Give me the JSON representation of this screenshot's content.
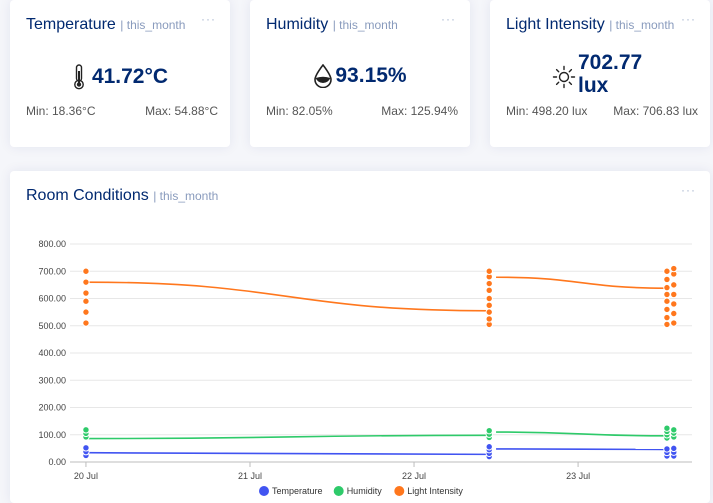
{
  "cards": {
    "temperature": {
      "title": "Temperature",
      "period": "| this_month",
      "value": "41.72°C",
      "min": "Min: 18.36°C",
      "max": "Max: 54.88°C",
      "icon": "thermometer-icon"
    },
    "humidity": {
      "title": "Humidity",
      "period": "| this_month",
      "value": "93.15%",
      "min": "Min: 82.05%",
      "max": "Max: 125.94%",
      "icon": "water-drop-icon"
    },
    "light": {
      "title": "Light Intensity",
      "period": "| this_month",
      "value_line1": "702.77",
      "value_line2": "lux",
      "min": "Min: 498.20 lux",
      "max": "Max: 706.83 lux",
      "icon": "sun-icon"
    }
  },
  "room": {
    "title": "Room Conditions",
    "period": "| this_month"
  },
  "menu_label": "···",
  "colors": {
    "navy": "#012970",
    "temperature": "#4154f1",
    "humidity": "#2eca6a",
    "light": "#ff771d"
  },
  "chart_data": {
    "type": "line",
    "y_ticks": [
      "800.00",
      "700.00",
      "600.00",
      "500.00",
      "400.00",
      "300.00",
      "200.00",
      "100.00",
      "0.00"
    ],
    "ylim": [
      0,
      800
    ],
    "x_ticks": [
      "20 Jul",
      "21 Jul",
      "22 Jul",
      "23 Jul"
    ],
    "xlim": [
      "2024-07-19T21:40",
      "2024-07-23T16:40"
    ],
    "series": [
      {
        "name": "Light Intensity",
        "color": "#ff771d",
        "segments": [
          [
            [
              "2024-07-20T00:00",
              660
            ],
            [
              "2024-07-22T11:00",
              555
            ]
          ],
          [
            [
              "2024-07-22T12:00",
              678
            ],
            [
              "2024-07-23T13:00",
              638
            ]
          ]
        ],
        "point_clusters": [
          {
            "x": "2024-07-20T00:00",
            "values": [
              510,
              550,
              590,
              620,
              660,
              700
            ]
          },
          {
            "x": "2024-07-22T11:00",
            "values": [
              505,
              525,
              550,
              575,
              600,
              630,
              655,
              680,
              700
            ]
          },
          {
            "x": "2024-07-23T13:00",
            "values": [
              505,
              530,
              560,
              590,
              615,
              640,
              670,
              700
            ]
          },
          {
            "x": "2024-07-23T14:00",
            "values": [
              510,
              545,
              580,
              615,
              650,
              690,
              710
            ]
          }
        ]
      },
      {
        "name": "Humidity",
        "color": "#2eca6a",
        "segments": [
          [
            [
              "2024-07-20T00:00",
              86
            ],
            [
              "2024-07-22T11:00",
              98
            ]
          ],
          [
            [
              "2024-07-22T12:00",
              110
            ],
            [
              "2024-07-23T13:00",
              96
            ]
          ]
        ],
        "point_clusters": [
          {
            "x": "2024-07-20T00:00",
            "values": [
              92,
              105,
              118
            ]
          },
          {
            "x": "2024-07-22T11:00",
            "values": [
              90,
              102,
              115
            ]
          },
          {
            "x": "2024-07-23T13:00",
            "values": [
              88,
              100,
              112,
              124
            ]
          },
          {
            "x": "2024-07-23T14:00",
            "values": [
              92,
              106,
              118
            ]
          }
        ]
      },
      {
        "name": "Temperature",
        "color": "#4154f1",
        "segments": [
          [
            [
              "2024-07-20T00:00",
              34
            ],
            [
              "2024-07-22T11:00",
              28
            ]
          ],
          [
            [
              "2024-07-22T12:00",
              48
            ],
            [
              "2024-07-23T13:00",
              46
            ]
          ]
        ],
        "point_clusters": [
          {
            "x": "2024-07-20T00:00",
            "values": [
              24,
              38,
              52
            ]
          },
          {
            "x": "2024-07-22T11:00",
            "values": [
              20,
              32,
              45,
              56
            ]
          },
          {
            "x": "2024-07-23T13:00",
            "values": [
              22,
              35,
              48
            ]
          },
          {
            "x": "2024-07-23T14:00",
            "values": [
              22,
              36,
              50
            ]
          }
        ]
      }
    ],
    "legend": [
      "Temperature",
      "Humidity",
      "Light Intensity"
    ],
    "legend_position": "bottom"
  }
}
